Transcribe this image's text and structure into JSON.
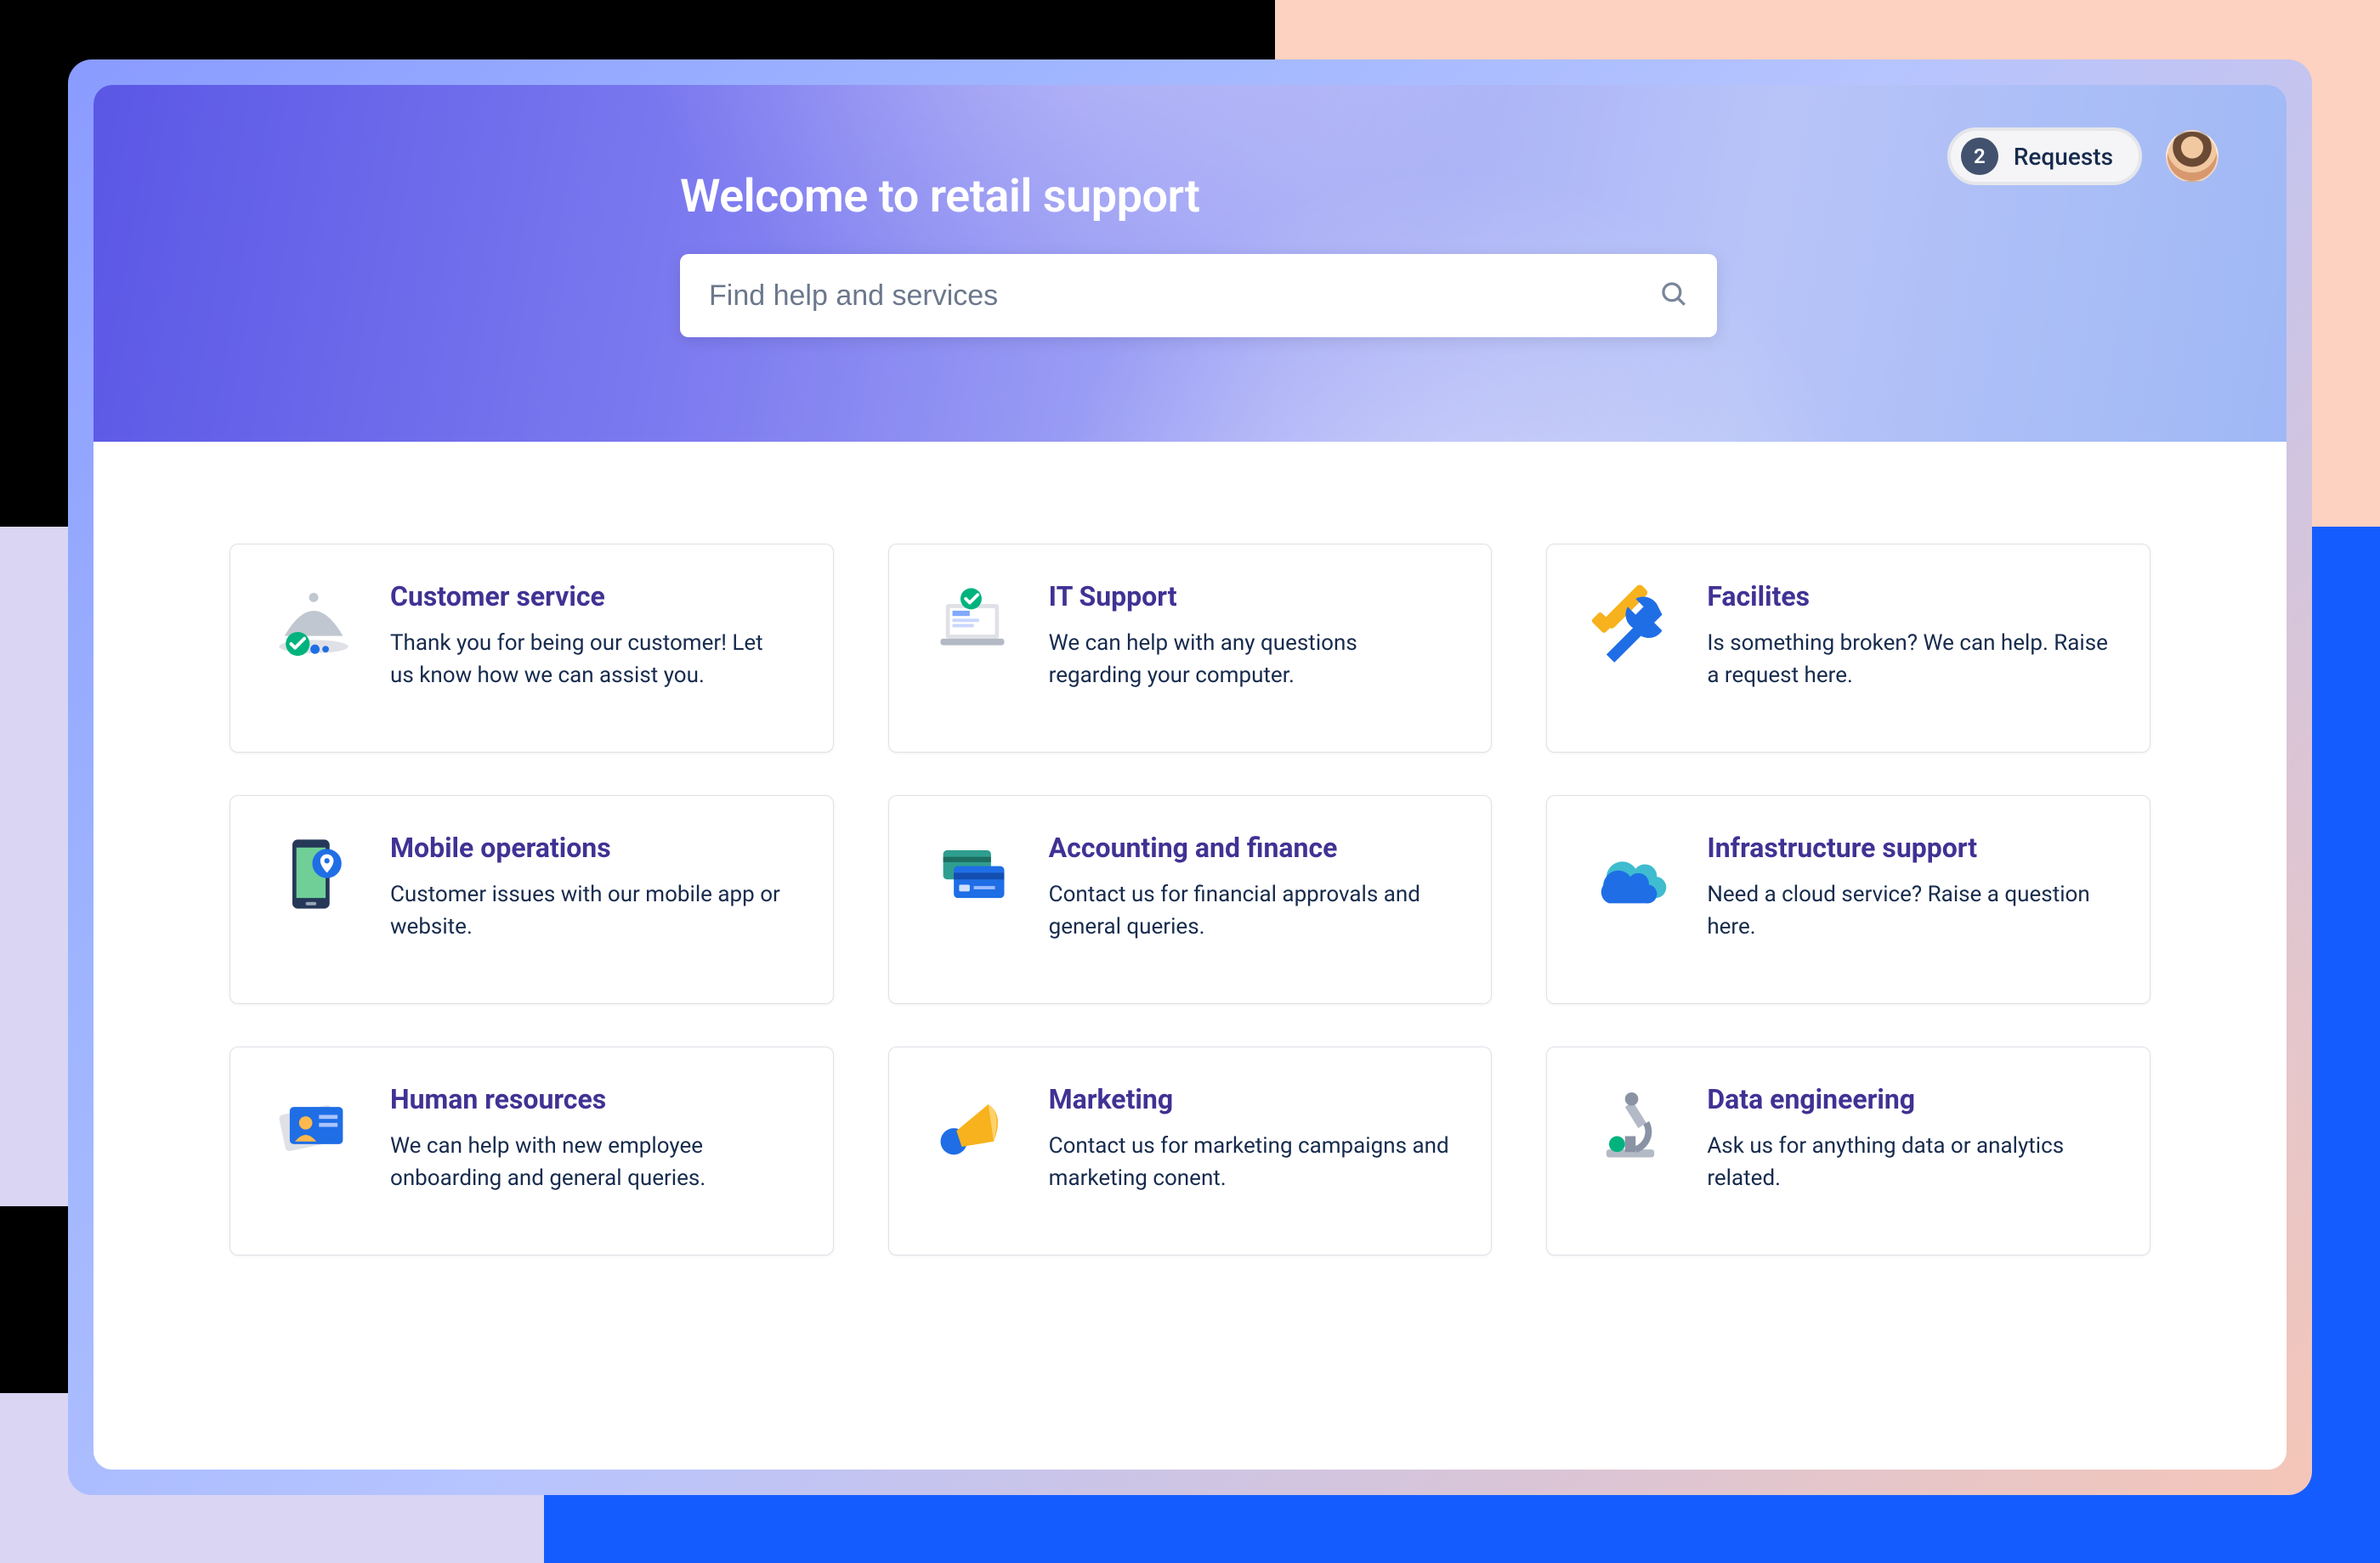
{
  "colors": {
    "accent": "#403294",
    "text": "#172b4d",
    "frame_gradient": [
      "#8a9bff",
      "#f5c6b8"
    ],
    "hero_gradient": [
      "#5b57e6",
      "#9fb8f5"
    ]
  },
  "hero": {
    "title": "Welcome to retail support"
  },
  "search": {
    "placeholder": "Find help and services",
    "value": ""
  },
  "requests": {
    "count": "2",
    "label": "Requests"
  },
  "cards": [
    {
      "icon": "service-dish-icon",
      "title": "Customer service",
      "desc": "Thank you for being our customer! Let us know how we can assist you."
    },
    {
      "icon": "laptop-check-icon",
      "title": "IT Support",
      "desc": "We can help with any questions regarding your computer."
    },
    {
      "icon": "tools-icon",
      "title": "Facilites",
      "desc": "Is something broken? We can help. Raise a request here."
    },
    {
      "icon": "mobile-pin-icon",
      "title": "Mobile operations",
      "desc": "Customer issues with our mobile app or website."
    },
    {
      "icon": "credit-cards-icon",
      "title": "Accounting and finance",
      "desc": "Contact us for financial approvals and general queries."
    },
    {
      "icon": "cloud-icon",
      "title": "Infrastructure support",
      "desc": "Need a cloud service? Raise a question here."
    },
    {
      "icon": "id-card-icon",
      "title": "Human resources",
      "desc": "We can help with new employee onboarding and general queries."
    },
    {
      "icon": "megaphone-icon",
      "title": "Marketing",
      "desc": "Contact us for marketing campaigns and marketing conent."
    },
    {
      "icon": "microscope-icon",
      "title": "Data engineering",
      "desc": "Ask us for anything data or analytics related."
    }
  ]
}
